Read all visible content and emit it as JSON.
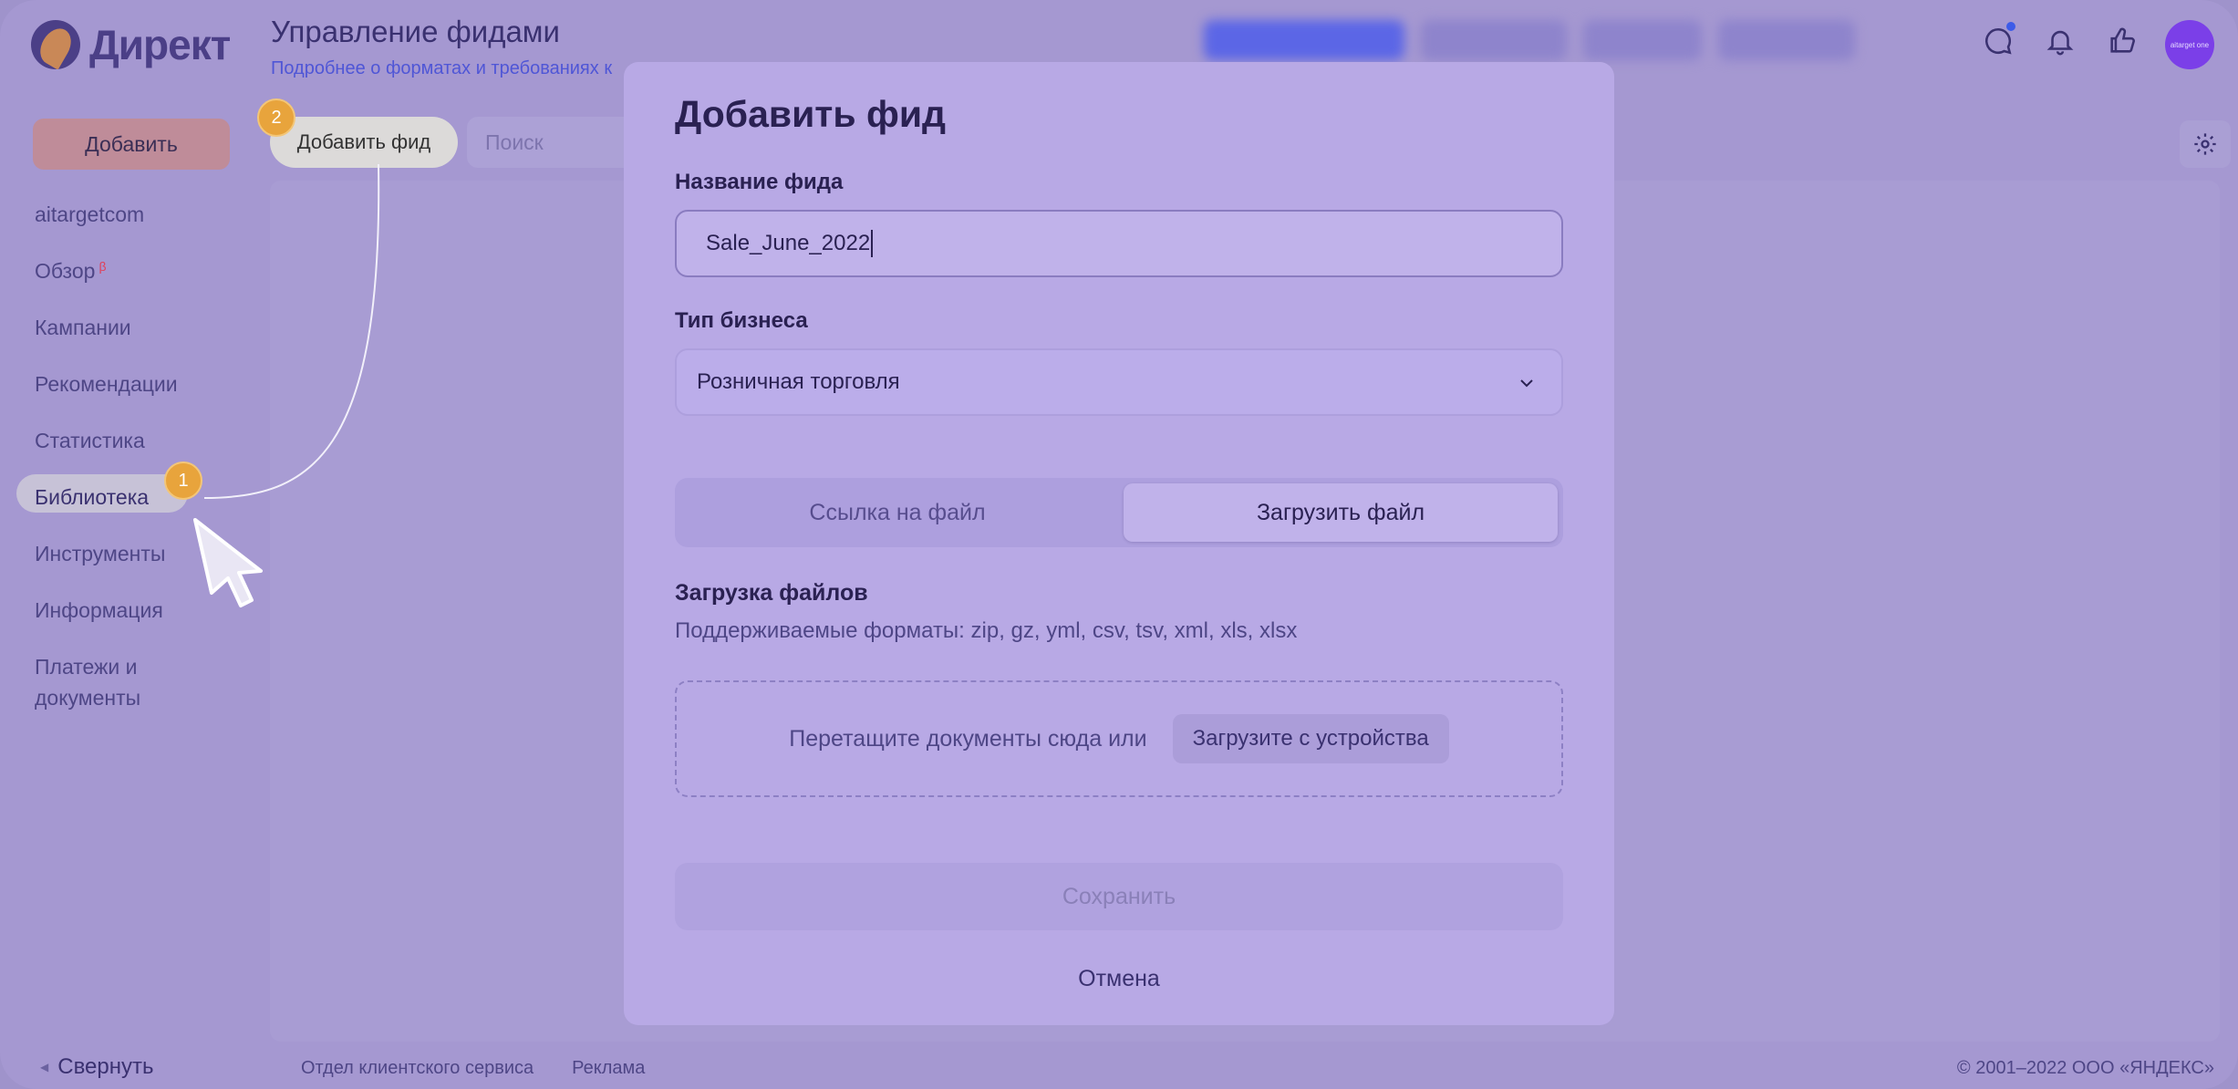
{
  "header": {
    "logo_text": "Директ",
    "title": "Управление фидами",
    "subtitle": "Подробнее о форматах и требованиях к",
    "avatar_text": "aitarget one"
  },
  "sidebar": {
    "add_button": "Добавить",
    "items": [
      {
        "label": "aitargetcom"
      },
      {
        "label": "Обзор",
        "sup": "β"
      },
      {
        "label": "Кампании"
      },
      {
        "label": "Рекомендации"
      },
      {
        "label": "Статистика"
      },
      {
        "label": "Библиотека",
        "active": true
      },
      {
        "label": "Инструменты"
      },
      {
        "label": "Информация"
      },
      {
        "label": "Платежи и документы"
      }
    ],
    "collapse_label": "Свернуть"
  },
  "toolbar": {
    "add_feed_label": "Добавить фид",
    "search_placeholder": "Поиск"
  },
  "footer": {
    "links": [
      "Отдел клиентского сервиса",
      "Реклама"
    ],
    "copyright": "© 2001–2022 ООО «ЯНДЕКС»"
  },
  "annotations": {
    "step1": "1",
    "step2": "2"
  },
  "modal": {
    "title": "Добавить фид",
    "feed_name_label": "Название фида",
    "feed_name_value": "Sale_June_2022",
    "business_type_label": "Тип бизнеса",
    "business_type_value": "Розничная торговля",
    "segment_link": "Ссылка на файл",
    "segment_upload": "Загрузить файл",
    "segment_selected": "Загрузить файл",
    "upload_title": "Загрузка файлов",
    "upload_formats": "Поддерживаемые форматы: zip, gz, yml, csv, tsv, xml, xls, xlsx",
    "dropzone_text": "Перетащите документы сюда или",
    "dropzone_button": "Загрузите с устройства",
    "save_label": "Сохранить",
    "cancel_label": "Отмена"
  },
  "colors": {
    "overlay": "#a598d1",
    "modal_bg": "#b8a9e5",
    "accent_link": "#4f56d6",
    "badge": "#e8a43c"
  },
  "icons": [
    "chat-icon",
    "bell-icon",
    "thumbs-up-icon",
    "gear-icon",
    "chevron-down-icon",
    "cursor-icon"
  ]
}
